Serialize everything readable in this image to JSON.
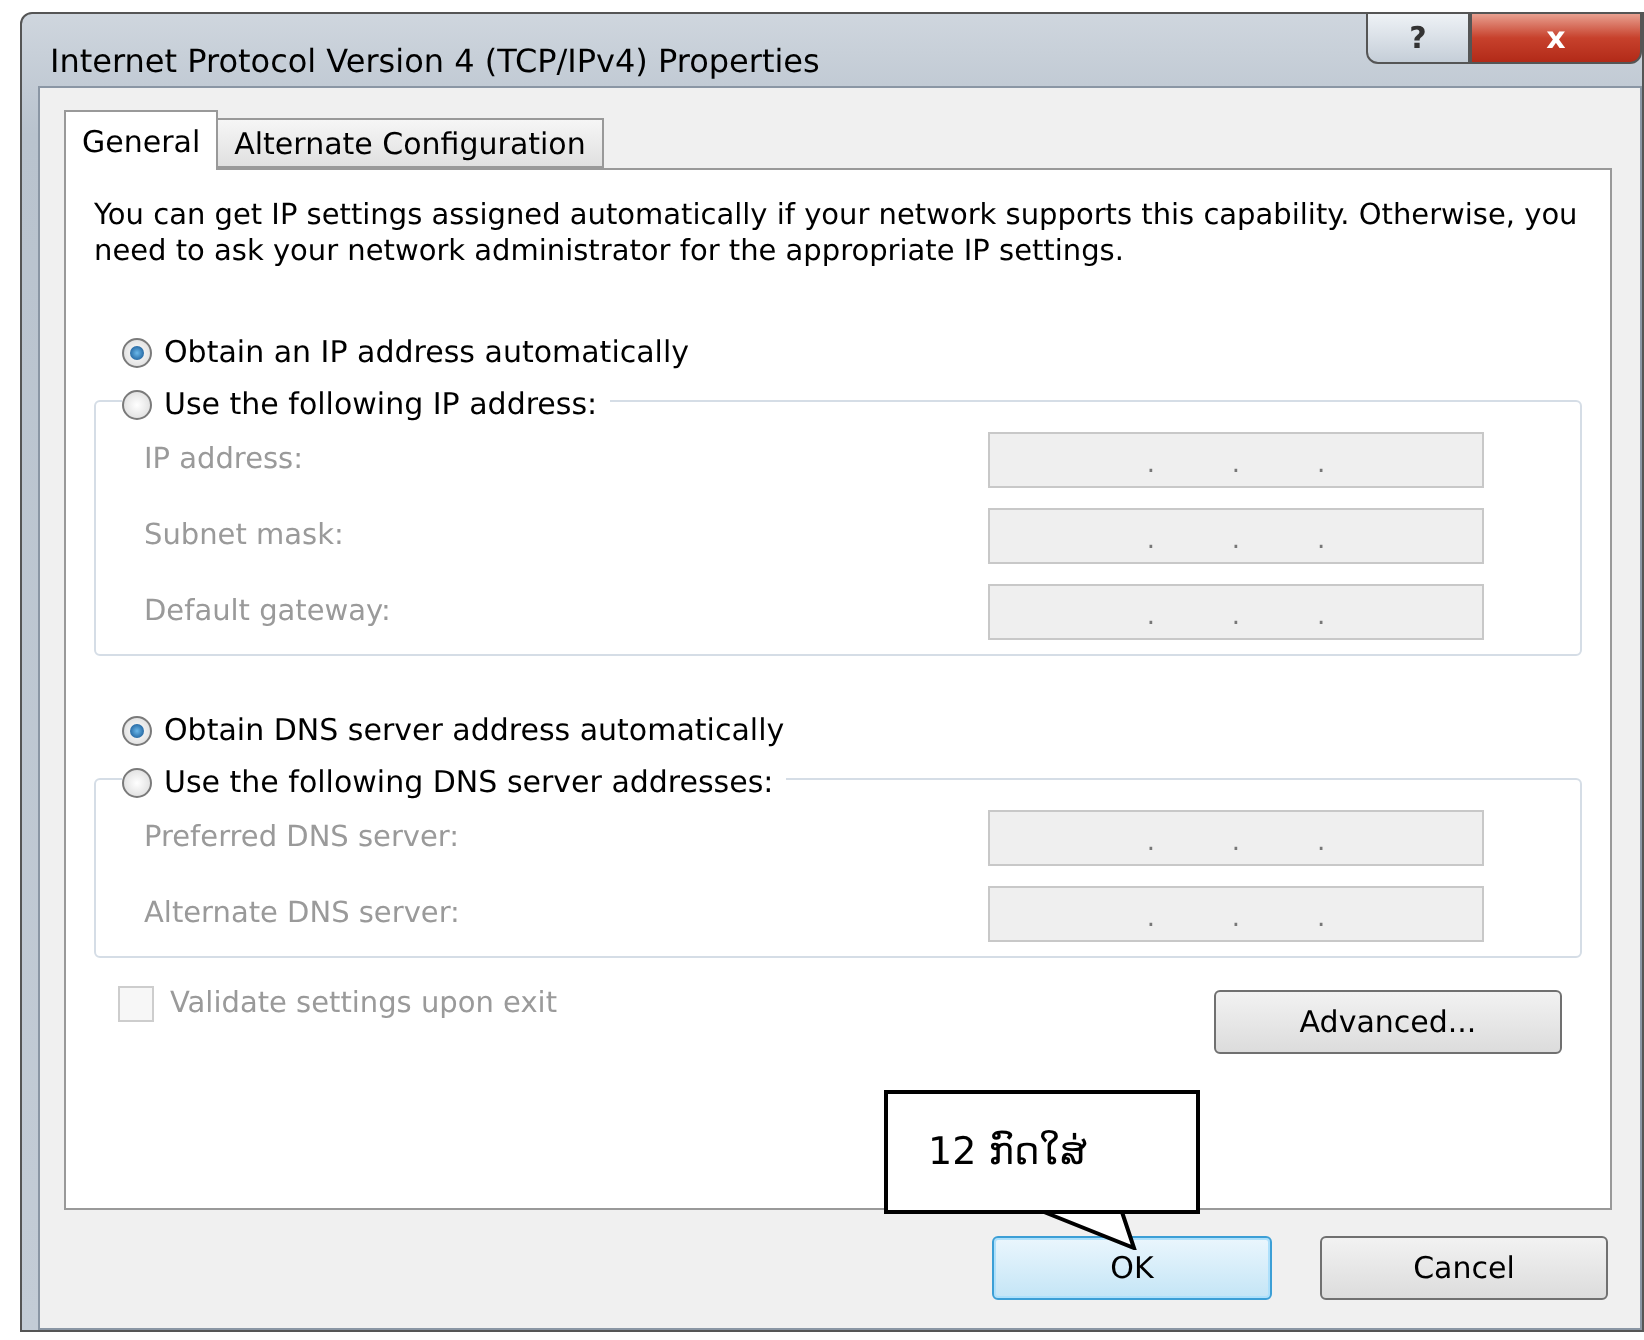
{
  "window": {
    "title": "Internet Protocol Version 4 (TCP/IPv4) Properties",
    "help_button": "?",
    "close_button": "x"
  },
  "tabs": [
    {
      "label": "General",
      "selected": true
    },
    {
      "label": "Alternate Configuration",
      "selected": false
    }
  ],
  "description": "You can get IP settings assigned automatically if your network supports this capability. Otherwise, you need to ask your network administrator for the appropriate IP settings.",
  "sections": [
    {
      "auto_option": {
        "label": "Obtain an IP address automatically",
        "selected": true
      },
      "manual_option": {
        "label": "Use the following IP address:",
        "selected": false
      },
      "fields": [
        {
          "label": "IP address:",
          "disabled": true,
          "separators": [
            ".",
            ".",
            "."
          ]
        },
        {
          "label": "Subnet mask:",
          "disabled": true,
          "separators": [
            ".",
            ".",
            "."
          ]
        },
        {
          "label": "Default gateway:",
          "disabled": true,
          "separators": [
            ".",
            ".",
            "."
          ]
        }
      ]
    },
    {
      "auto_option": {
        "label": "Obtain DNS server address automatically",
        "selected": true
      },
      "manual_option": {
        "label": "Use the following DNS server addresses:",
        "selected": false
      },
      "fields": [
        {
          "label": "Preferred DNS server:",
          "disabled": true,
          "separators": [
            ".",
            ".",
            "."
          ]
        },
        {
          "label": "Alternate DNS server:",
          "disabled": true,
          "separators": [
            ".",
            ".",
            "."
          ]
        }
      ]
    }
  ],
  "validate_checkbox": {
    "label": "Validate settings upon exit",
    "checked": false,
    "disabled": true
  },
  "advanced_button": "Advanced...",
  "callout": "12 ກົດໃສ່",
  "buttons": [
    {
      "label": "OK",
      "focused": true
    },
    {
      "label": "Cancel",
      "focused": false
    }
  ]
}
